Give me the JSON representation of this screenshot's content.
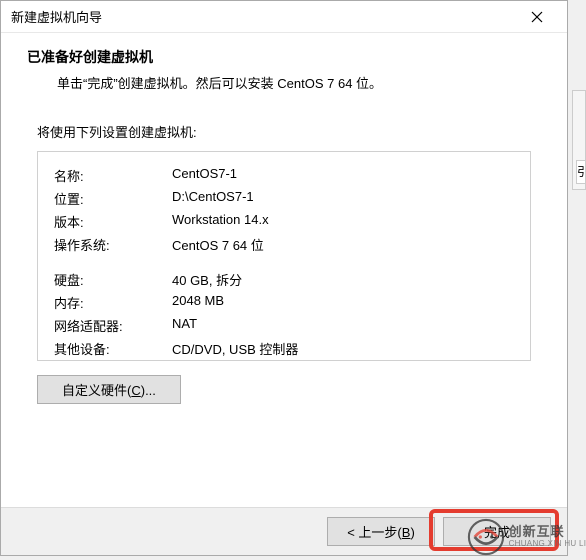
{
  "window": {
    "title": "新建虚拟机向导"
  },
  "header": {
    "title": "已准备好创建虚拟机",
    "subtitle": "单击“完成”创建虚拟机。然后可以安装 CentOS 7 64 位。"
  },
  "body": {
    "label": "将使用下列设置创建虚拟机:"
  },
  "settings": {
    "name_label": "名称:",
    "name_value": "CentOS7-1",
    "location_label": "位置:",
    "location_value": "D:\\CentOS7-1",
    "version_label": "版本:",
    "version_value": "Workstation 14.x",
    "os_label": "操作系统:",
    "os_value": "CentOS 7 64 位",
    "disk_label": "硬盘:",
    "disk_value": "40 GB, 拆分",
    "memory_label": "内存:",
    "memory_value": "2048 MB",
    "net_label": "网络适配器:",
    "net_value": "NAT",
    "other_label": "其他设备:",
    "other_value": "CD/DVD, USB 控制器"
  },
  "buttons": {
    "customize": "自定义硬件(C)...",
    "back": "< 上一步(B)",
    "finish": "完成"
  },
  "watermark": {
    "cn": "创新互联",
    "en": "CHUANG XIN HU LIAN"
  },
  "side": {
    "key": "引"
  }
}
